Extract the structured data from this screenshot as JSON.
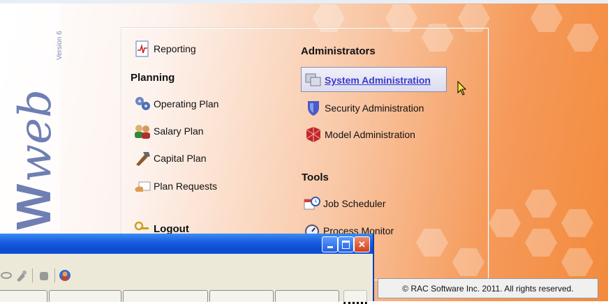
{
  "logo": {
    "version": "Version 6",
    "mw": "MW",
    "web": "web"
  },
  "menu": {
    "reporting": "Reporting",
    "planning_heading": "Planning",
    "operating_plan": "Operating Plan",
    "salary_plan": "Salary Plan",
    "capital_plan": "Capital Plan",
    "plan_requests": "Plan Requests",
    "logout": "Logout",
    "admin_heading": "Administrators",
    "system_admin": "System Administration",
    "security_admin": "Security Administration",
    "model_admin": "Model Administration",
    "tools_heading": "Tools",
    "job_scheduler": "Job Scheduler",
    "process_monitor": "Process Monitor"
  },
  "footer": {
    "copyright": "© RAC Software Inc. 2011. All rights reserved."
  },
  "colors": {
    "accent_orange": "#f38a3c",
    "logo_blue": "#6f7fb3",
    "link_blue": "#3a3acd",
    "xp_title_blue": "#0a4bd0"
  }
}
